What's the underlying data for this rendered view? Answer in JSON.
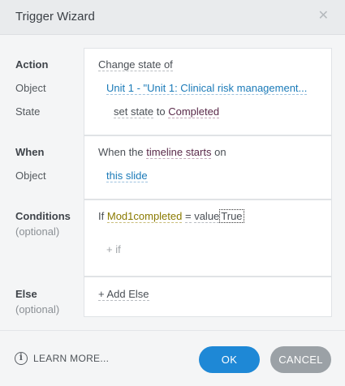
{
  "dialog": {
    "title": "Trigger Wizard",
    "close_symbol": "✕"
  },
  "action_section": {
    "label": "Action",
    "object_label": "Object",
    "state_label": "State",
    "action_value": "Change state of",
    "object_value": "Unit 1 - \"Unit 1: Clinical risk management...",
    "set_state": "set state",
    "to_word": "to",
    "state_value": "Completed"
  },
  "when_section": {
    "label": "When",
    "object_label": "Object",
    "when_prefix": "When the",
    "event_value": "timeline starts",
    "on_word": "on",
    "object_value": "this slide"
  },
  "conditions_section": {
    "label": "Conditions",
    "optional": "(optional)",
    "if_word": "If",
    "variable": "Mod1completed",
    "operator": "=",
    "value_type": "value",
    "value": "True",
    "add_if": "+ if"
  },
  "else_section": {
    "label": "Else",
    "optional": "(optional)",
    "add_else": "+ Add Else"
  },
  "footer": {
    "learn_more": "LEARN MORE...",
    "ok_label": "OK",
    "cancel_label": "CANCEL"
  }
}
